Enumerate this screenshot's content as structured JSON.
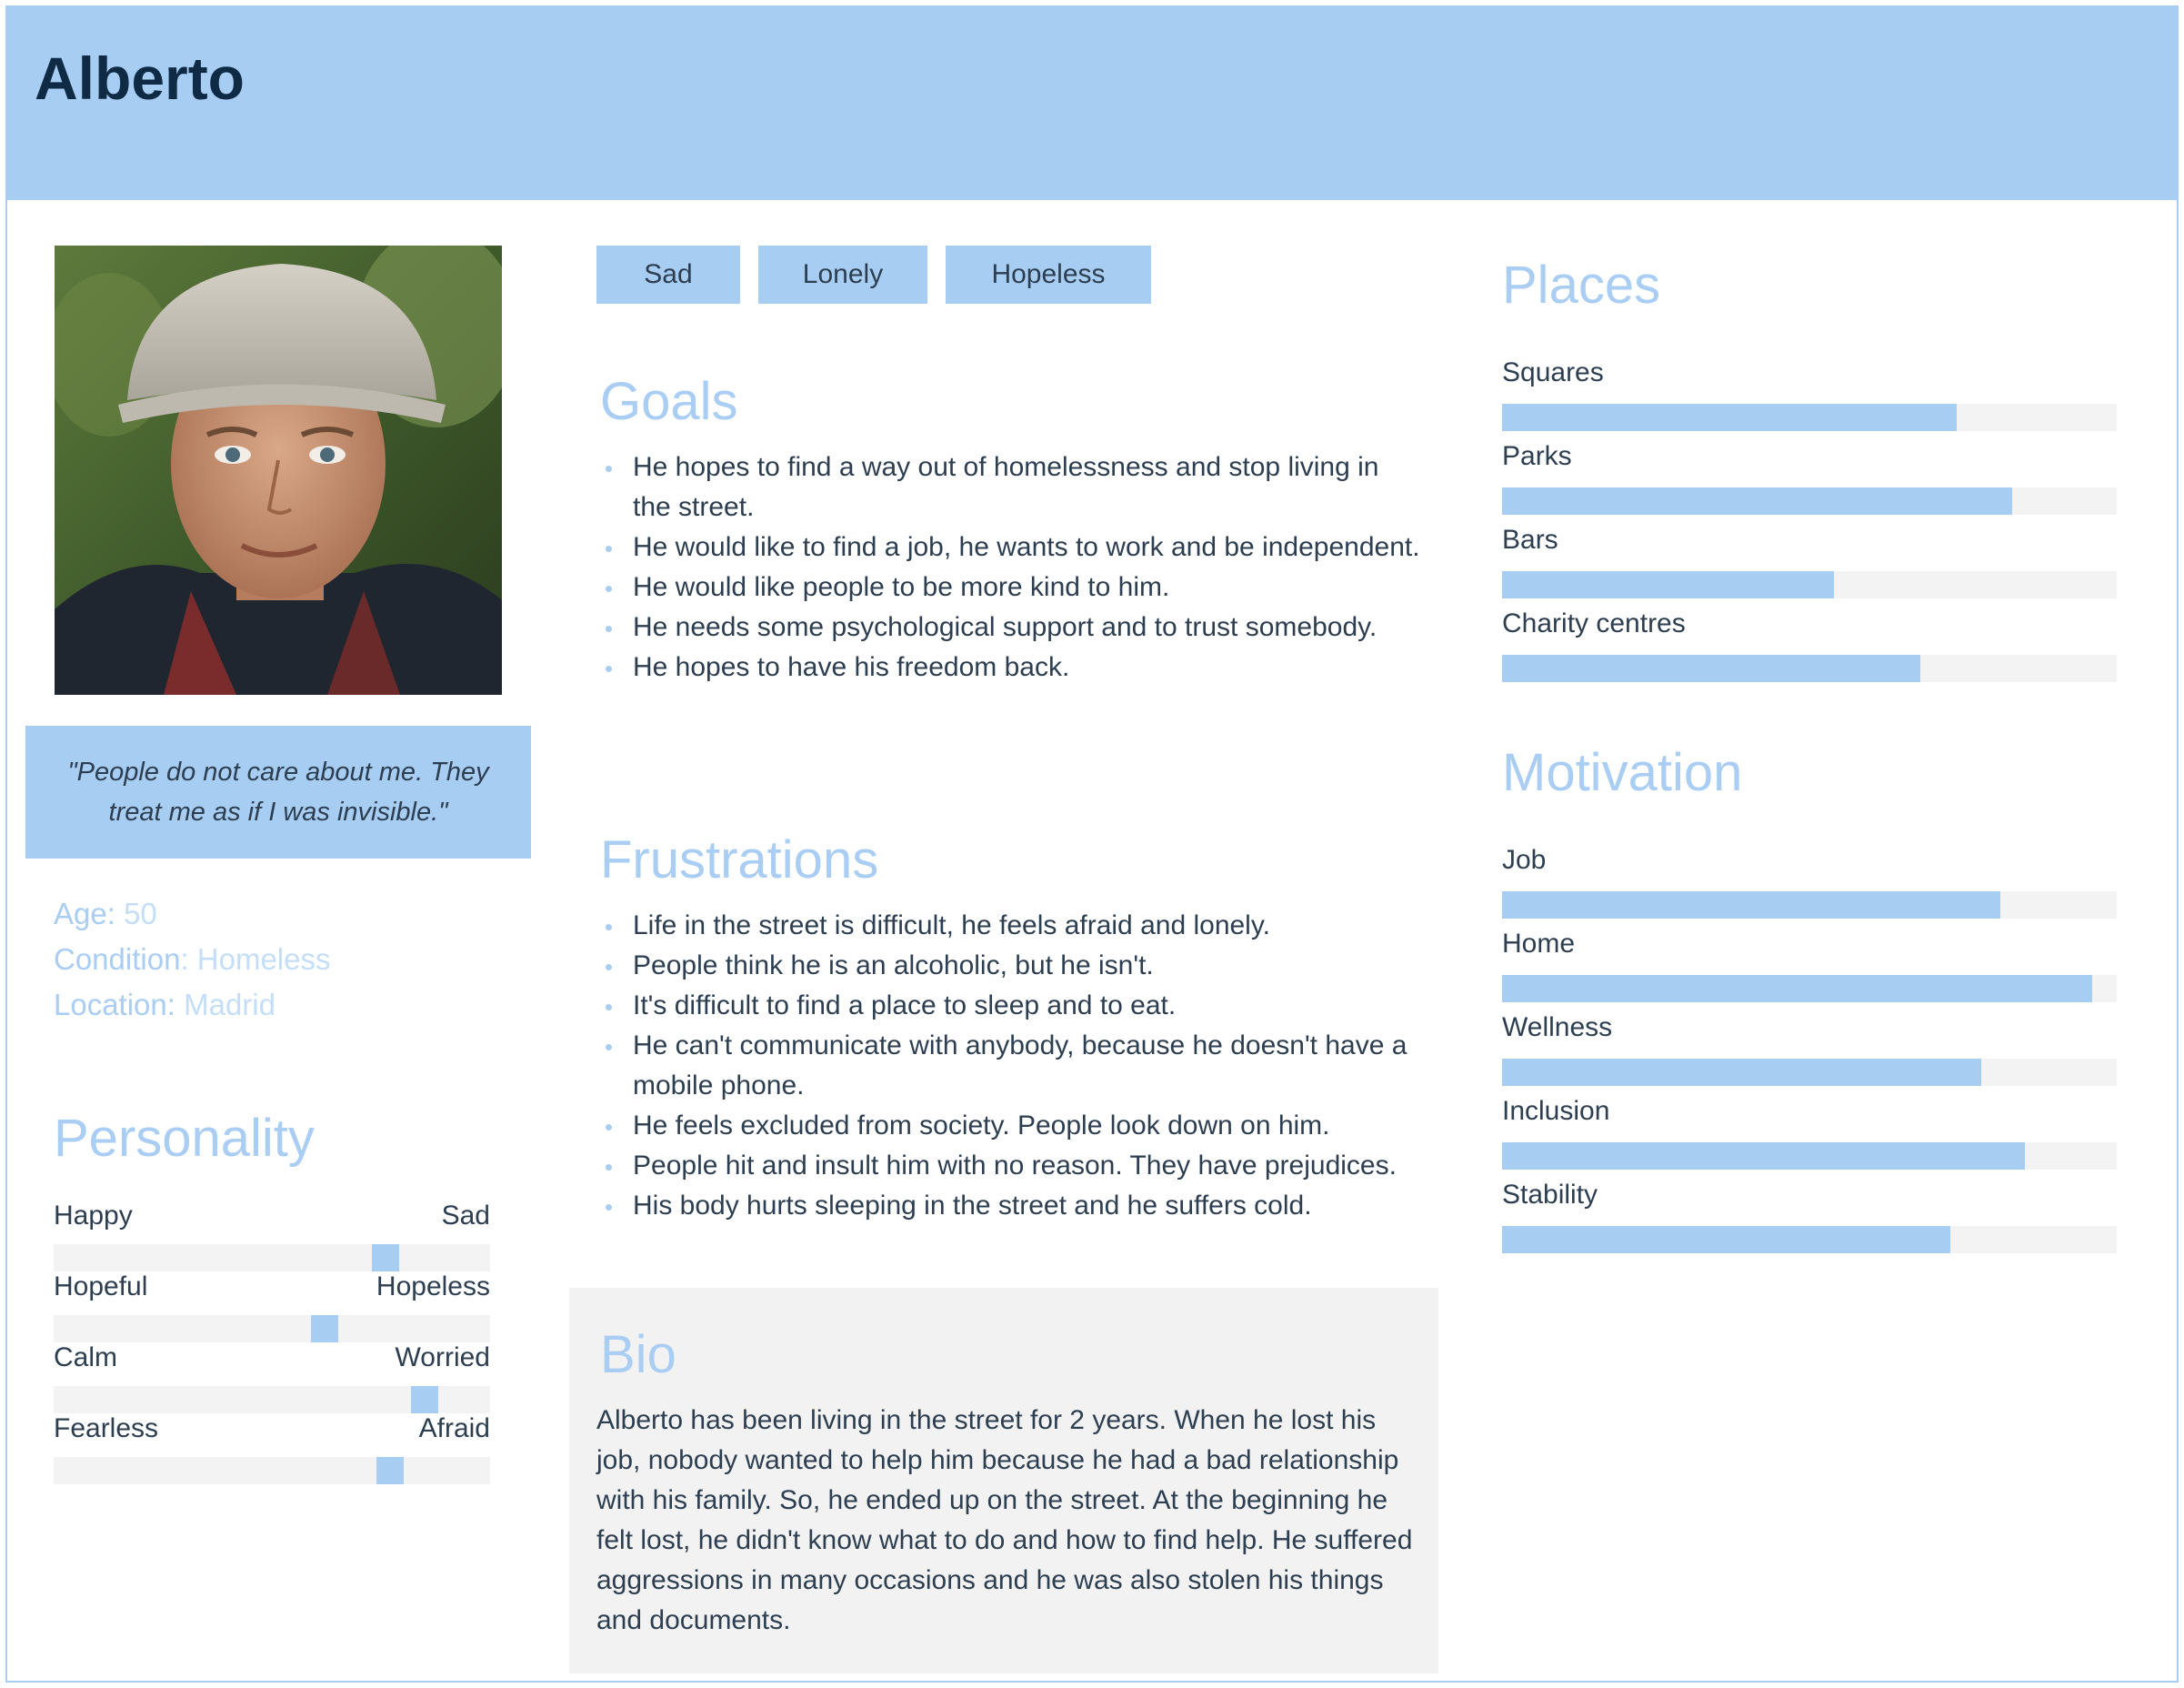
{
  "persona": {
    "name": "Alberto",
    "quote": "\"People do not care about me. They treat me as if I was invisible.\"",
    "age_label": "Age:",
    "age": "50",
    "condition_label": "Condition",
    "condition": "Homeless",
    "location_label": "Location:",
    "location": "Madrid"
  },
  "tags": [
    "Sad",
    "Lonely",
    "Hopeless"
  ],
  "personality": {
    "title": "Personality",
    "scales": [
      {
        "left": "Happy",
        "right": "Sad",
        "value": 0.76
      },
      {
        "left": "Hopeful",
        "right": "Hopeless",
        "value": 0.62
      },
      {
        "left": "Calm",
        "right": "Worried",
        "value": 0.85
      },
      {
        "left": "Fearless",
        "right": "Afraid",
        "value": 0.77
      }
    ]
  },
  "goals": {
    "title": "Goals",
    "items": [
      "He hopes to find a way out of homelessness and stop living in the street.",
      "He would like to find a job, he wants to work and be independent.",
      "He would like people to be more kind to him.",
      "He needs some psychological support and to trust somebody.",
      "He hopes to have his freedom back."
    ]
  },
  "frustrations": {
    "title": "Frustrations",
    "items": [
      "Life in the street is difficult, he feels afraid and lonely.",
      "People think he is an alcoholic, but he isn't.",
      "It's difficult to find a place to sleep and to eat.",
      "He can't communicate with anybody, because he doesn't have a mobile phone.",
      "He feels excluded from society. People look down on him.",
      "People hit and insult him with no reason. They have prejudices.",
      "His body hurts sleeping in the street and he suffers cold."
    ]
  },
  "bio": {
    "title": "Bio",
    "text": "Alberto has been living in the street for 2 years. When he lost his job, nobody wanted to help him because he had a bad relationship with his family. So, he ended up on the street. At the beginning he felt lost, he didn't know what to do and how to find help. He suffered aggressions in many occasions and he was also stolen his things and documents."
  },
  "places": {
    "title": "Places",
    "items": [
      {
        "label": "Squares",
        "value": 0.74
      },
      {
        "label": "Parks",
        "value": 0.83
      },
      {
        "label": "Bars",
        "value": 0.54
      },
      {
        "label": "Charity centres",
        "value": 0.68
      }
    ]
  },
  "motivation": {
    "title": "Motivation",
    "items": [
      {
        "label": "Job",
        "value": 0.81
      },
      {
        "label": "Home",
        "value": 0.96
      },
      {
        "label": "Wellness",
        "value": 0.78
      },
      {
        "label": "Inclusion",
        "value": 0.85
      },
      {
        "label": "Stability",
        "value": 0.73
      }
    ]
  },
  "colors": {
    "accent": "#a8cdf3",
    "header_text": "#0f2a44",
    "body_text": "#2c3e50",
    "track": "#f3f3f3",
    "bio_background": "#f2f2f2"
  }
}
